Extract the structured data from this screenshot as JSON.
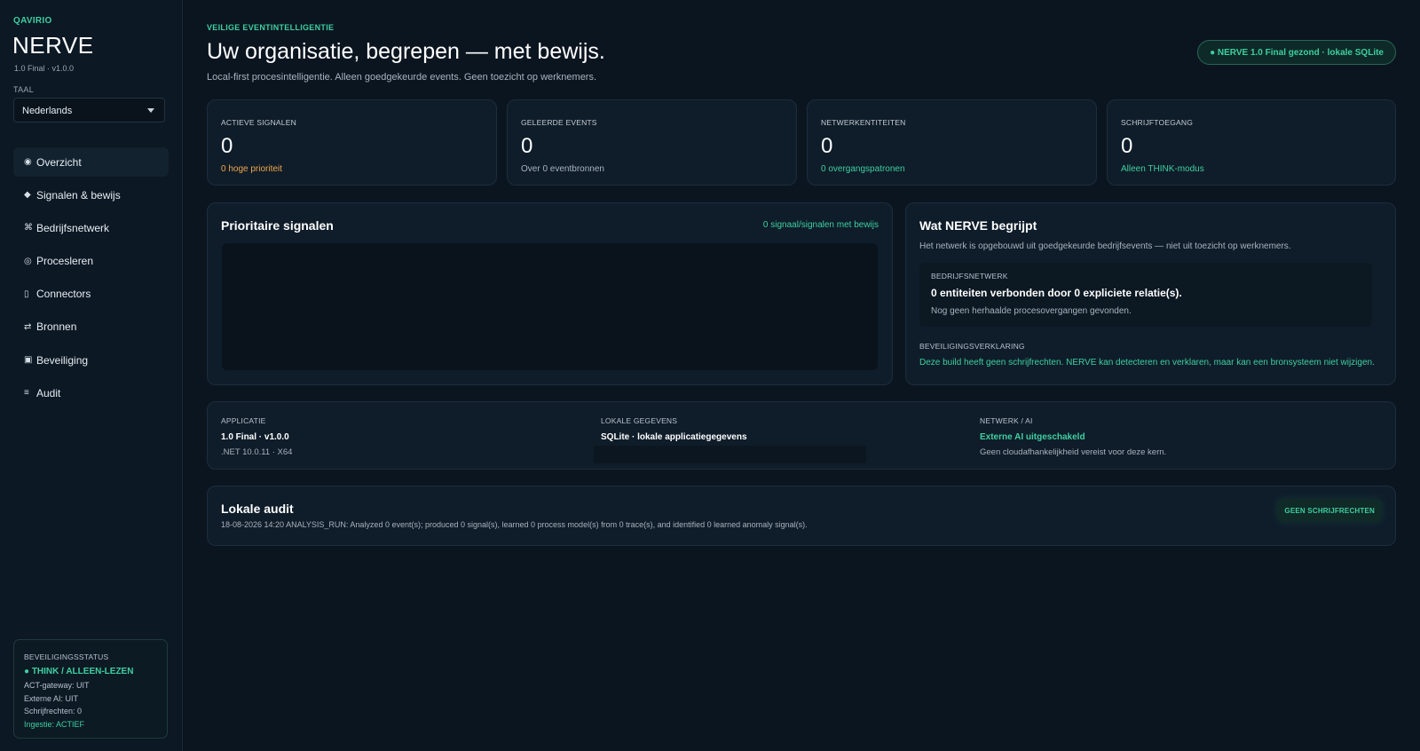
{
  "sidebar": {
    "brand_small": "QAVIRIO",
    "brand_title": "NERVE",
    "version": "1.0 Final · v1.0.0",
    "language_label": "TAAL",
    "language_value": "Nederlands",
    "items": [
      {
        "icon": "◉",
        "label": "Overzicht"
      },
      {
        "icon": "◆",
        "label": "Signalen & bewijs"
      },
      {
        "icon": "⌘",
        "label": "Bedrijfsnetwerk"
      },
      {
        "icon": "◎",
        "label": "Procesleren"
      },
      {
        "icon": "▯",
        "label": "Connectors"
      },
      {
        "icon": "⇄",
        "label": "Bronnen"
      },
      {
        "icon": "▣",
        "label": "Beveiliging"
      },
      {
        "icon": "≡",
        "label": "Audit"
      }
    ],
    "security": {
      "title": "BEVEILIGINGSSTATUS",
      "mode": "● THINK / ALLEEN-LEZEN",
      "act_gateway": "ACT-gateway: UIT",
      "external_ai": "Externe AI: UIT",
      "write_rights": "Schrijfrechten: 0",
      "ingestion": "Ingestie: ACTIEF"
    }
  },
  "header": {
    "kicker": "VEILIGE EVENTINTELLIGENTIE",
    "title": "Uw organisatie, begrepen — met bewijs.",
    "subtitle": "Local-first procesintelligentie. Alleen goedgekeurde events. Geen toezicht op werknemers.",
    "health": "● NERVE 1.0 Final gezond · lokale SQLite"
  },
  "kpis": [
    {
      "label": "ACTIEVE SIGNALEN",
      "value": "0",
      "sub": "0 hoge prioriteit"
    },
    {
      "label": "GELEERDE EVENTS",
      "value": "0",
      "sub": "Over 0 eventbronnen"
    },
    {
      "label": "NETWERKENTITEITEN",
      "value": "0",
      "sub": "0 overgangspatronen"
    },
    {
      "label": "SCHRIJFTOEGANG",
      "value": "0",
      "sub": "Alleen THINK-modus"
    }
  ],
  "signals": {
    "title": "Prioritaire signalen",
    "count": "0 signaal/signalen met bewijs"
  },
  "understanding": {
    "title": "Wat NERVE begrijpt",
    "subtitle": "Het netwerk is opgebouwd uit goedgekeurde bedrijfsevents — niet uit toezicht op werknemers.",
    "network_label": "BEDRIJFSNETWERK",
    "network_main": "0 entiteiten verbonden door 0 expliciete relatie(s).",
    "network_sub": "Nog geen herhaalde procesovergangen gevonden.",
    "declaration_label": "BEVEILIGINGSVERKLARING",
    "declaration_text": "Deze build heeft geen schrijfrechten. NERVE kan detecteren en verklaren, maar kan een bronsysteem niet wijzigen."
  },
  "info": {
    "app_label": "APPLICATIE",
    "app_main": "1.0 Final · v1.0.0",
    "app_sub": ".NET 10.0.11 · X64",
    "data_label": "LOKALE GEGEVENS",
    "data_main": "SQLite · lokale applicatiegegevens",
    "net_label": "NETWERK / AI",
    "net_main": "Externe AI uitgeschakeld",
    "net_sub": "Geen cloudafhankelijkheid vereist voor deze kern."
  },
  "audit": {
    "title": "Lokale audit",
    "entry": "18-08-2026 14:20  ANALYSIS_RUN: Analyzed 0 event(s); produced 0 signal(s), learned 0 process model(s) from 0 trace(s), and identified 0 learned anomaly signal(s).",
    "badge": "GEEN SCHRIJFRECHTEN"
  },
  "colors": {
    "accent": "#3fcf9f",
    "warning": "#f0a64a",
    "background": "#0b1520",
    "card": "#0f1d2a"
  }
}
